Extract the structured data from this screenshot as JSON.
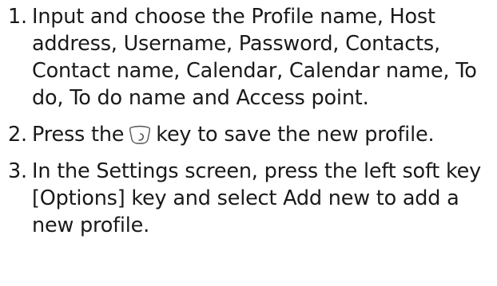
{
  "steps": [
    {
      "number": "1.",
      "text": "Input and choose the Profile name, Host address, Username, Password, Contacts, Contact name, Calendar, Calendar name, To do, To do name and Access point."
    },
    {
      "number": "2.",
      "text_before": "Press the",
      "key_icon": "soft-key-icon",
      "text_after": "key to save the new profile."
    },
    {
      "number": "3.",
      "text": "In the Settings screen, press the left soft key [Options] key and select Add new to add a new profile."
    }
  ]
}
